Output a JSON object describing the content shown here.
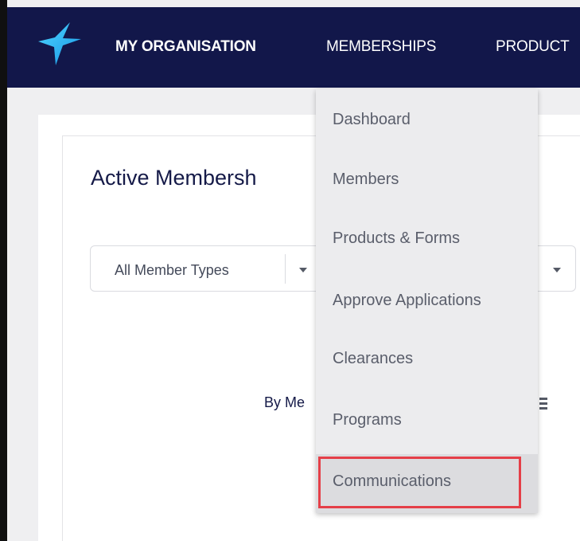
{
  "navbar": {
    "logo_icon": "star-logo-icon",
    "items": [
      {
        "label": "MY ORGANISATION"
      },
      {
        "label": "MEMBERSHIPS"
      },
      {
        "label": "PRODUCT"
      }
    ]
  },
  "page": {
    "title": "Active Membersh",
    "filter": {
      "selected": "All Member Types"
    },
    "chart_label": "By Me"
  },
  "dropdown": {
    "items": [
      {
        "label": "Dashboard"
      },
      {
        "label": "Members"
      },
      {
        "label": "Products & Forms"
      },
      {
        "label": "Approve Applications"
      },
      {
        "label": "Clearances"
      },
      {
        "label": "Programs"
      },
      {
        "label": "Communications"
      }
    ],
    "highlighted": "Communications"
  },
  "colors": {
    "navbar": "#12174a",
    "accent": "#29b8f0",
    "highlight_border": "#e53f48"
  }
}
